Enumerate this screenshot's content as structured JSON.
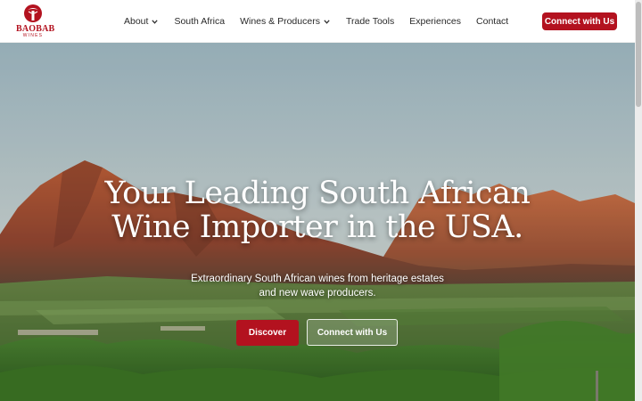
{
  "brand": {
    "name": "BAOBAB",
    "sub": "WINES",
    "color": "#b3121f",
    "icon": "baobab-tree-icon"
  },
  "nav": {
    "items": [
      {
        "label": "About",
        "has_dropdown": true
      },
      {
        "label": "South Africa",
        "has_dropdown": false
      },
      {
        "label": "Wines & Producers",
        "has_dropdown": true
      },
      {
        "label": "Trade Tools",
        "has_dropdown": false
      },
      {
        "label": "Experiences",
        "has_dropdown": false
      },
      {
        "label": "Contact",
        "has_dropdown": false
      }
    ],
    "cta_label": "Connect with Us"
  },
  "hero": {
    "headline_line1": "Your Leading South African",
    "headline_line2": "Wine Importer in the USA.",
    "subtitle_line1": "Extraordinary South African wines from heritage estates",
    "subtitle_line2": "and new wave producers.",
    "primary_button": "Discover",
    "secondary_button": "Connect with Us"
  }
}
